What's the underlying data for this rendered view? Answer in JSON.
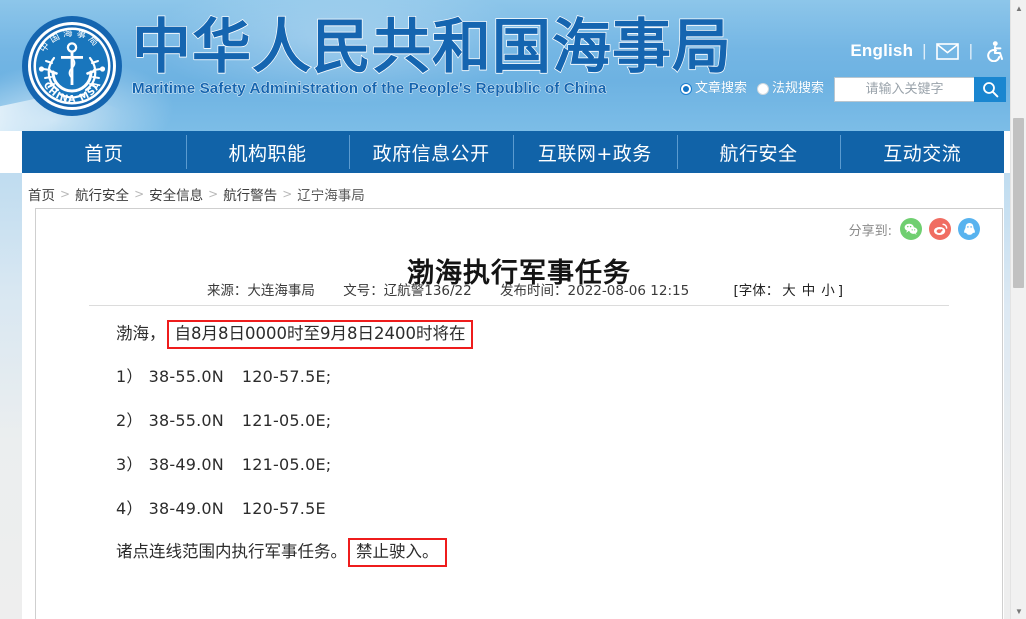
{
  "header": {
    "logo_alt": "china-msa-emblem",
    "logo_ring_top_text": "中国海事局",
    "logo_ring_bottom_text": "CHINA MSA",
    "cn_title": "中华人民共和国海事局",
    "en_title": "Maritime Safety Administration of the People's Republic of China",
    "utility": {
      "english_label": "English",
      "separator": "|",
      "mail_icon": "mail-icon",
      "accessibility_icon": "accessibility-icon"
    },
    "search": {
      "options": [
        {
          "label": "文章搜索",
          "selected": true
        },
        {
          "label": "法规搜索",
          "selected": false
        }
      ],
      "placeholder": "请输入关键字",
      "value": "",
      "button_icon": "search-icon"
    },
    "colors": {
      "banner_top": "#8dc6ea",
      "banner_base": "#74b6e4",
      "title_blue": "#1565b0",
      "search_button": "#1a86d0"
    }
  },
  "nav": {
    "items": [
      {
        "label": "首页"
      },
      {
        "label": "机构职能"
      },
      {
        "label": "政府信息公开"
      },
      {
        "label": "互联网+政务"
      },
      {
        "label": "航行安全"
      },
      {
        "label": "互动交流"
      }
    ],
    "bar_color": "#1163a8"
  },
  "breadcrumb": {
    "separator": ">",
    "items": [
      {
        "label": "首页"
      },
      {
        "label": "航行安全"
      },
      {
        "label": "安全信息"
      },
      {
        "label": "航行警告"
      },
      {
        "label": "辽宁海事局"
      }
    ]
  },
  "article": {
    "share": {
      "label": "分享到:",
      "targets": [
        {
          "name": "wechat",
          "color": "#6fcf70"
        },
        {
          "name": "weibo",
          "color": "#f06d62"
        },
        {
          "name": "qq",
          "color": "#58b3ef"
        }
      ]
    },
    "title": "渤海执行军事任务",
    "meta": {
      "source": "来源：大连海事局",
      "doc_no": "文号：辽航警136/22",
      "publish_time": "发布时间：2022-08-06 12:15",
      "font_label": "[字体：",
      "font_large": "大",
      "font_medium": "中",
      "font_small": "小",
      "font_close": "]"
    },
    "body": {
      "intro_prefix": "渤海，",
      "intro_highlight": "自8月8日0000时至9月8日2400时将在",
      "coordinates": [
        {
          "index": "1）",
          "lat": "38-55.0N",
          "lon": "120-57.5E;"
        },
        {
          "index": "2）",
          "lat": "38-55.0N",
          "lon": "121-05.0E;"
        },
        {
          "index": "3）",
          "lat": "38-49.0N",
          "lon": "121-05.0E;"
        },
        {
          "index": "4）",
          "lat": "38-49.0N",
          "lon": "120-57.5E"
        }
      ],
      "closing_prefix": "诸点连线范围内执行军事任务。",
      "closing_highlight": "禁止驶入。",
      "highlight_box_color": "#ee1c1c"
    }
  },
  "scrollbar": {
    "up_arrow": "▲",
    "down_arrow": "▼"
  }
}
